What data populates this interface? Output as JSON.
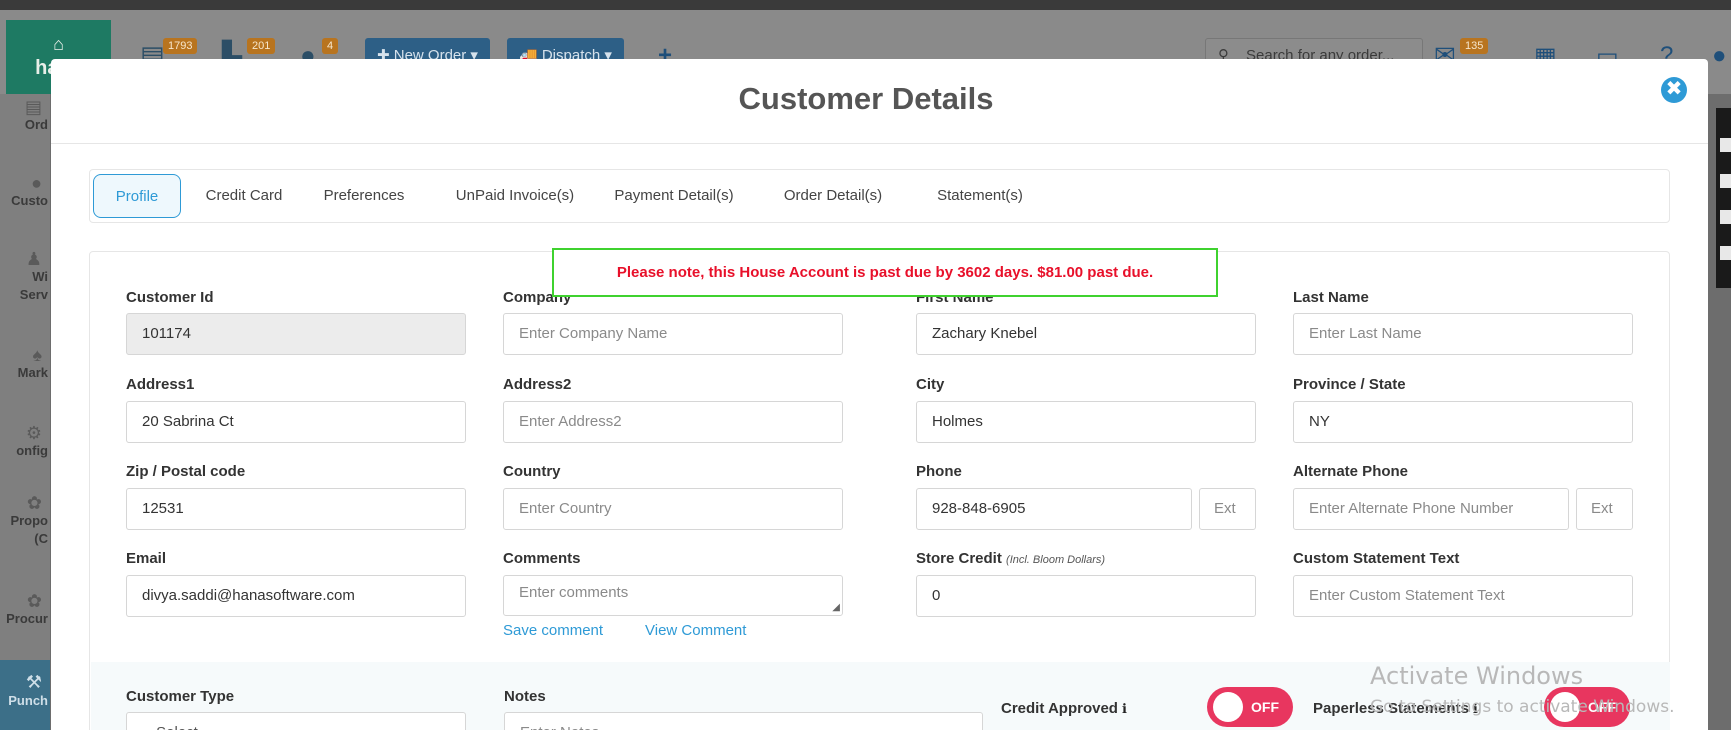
{
  "app": {
    "brand_text": "hana",
    "badges": {
      "orders": "1793",
      "deliveries": "201",
      "chat": "4",
      "mail": "135"
    },
    "new_order_label": "✚ New Order ▾",
    "dispatch_label": "🚚 Dispatch ▾",
    "search_placeholder": "Search for any order...",
    "sidebar": [
      "Ord",
      "Custo",
      "Wi",
      "Serv",
      "Mark",
      "onfig",
      "Propo",
      "(C",
      "Procur"
    ],
    "punch_label": "Punch"
  },
  "modal": {
    "title": "Customer Details",
    "close_glyph": "✖"
  },
  "tabs": [
    {
      "label": "Profile",
      "active": true
    },
    {
      "label": "Credit Card"
    },
    {
      "label": "Preferences"
    },
    {
      "label": "UnPaid Invoice(s)"
    },
    {
      "label": "Payment Detail(s)"
    },
    {
      "label": "Order Detail(s)"
    },
    {
      "label": "Statement(s)"
    }
  ],
  "alert": "Please note, this House Account is past due by 3602 days. $81.00 past due.",
  "fields": {
    "customer_id": {
      "label": "Customer Id",
      "value": "101174"
    },
    "company": {
      "label": "Company",
      "placeholder": "Enter Company Name"
    },
    "first_name": {
      "label": "First Name",
      "value": "Zachary Knebel"
    },
    "last_name": {
      "label": "Last Name",
      "placeholder": "Enter Last Name"
    },
    "address1": {
      "label": "Address1",
      "value": "20 Sabrina Ct"
    },
    "address2": {
      "label": "Address2",
      "placeholder": "Enter Address2"
    },
    "city": {
      "label": "City",
      "value": "Holmes"
    },
    "state": {
      "label": "Province / State",
      "value": "NY"
    },
    "zip": {
      "label": "Zip / Postal code",
      "value": "12531"
    },
    "country": {
      "label": "Country",
      "placeholder": "Enter Country"
    },
    "phone": {
      "label": "Phone",
      "value": "928-848-6905",
      "ext_placeholder": "Ext"
    },
    "alt_phone": {
      "label": "Alternate Phone",
      "placeholder": "Enter Alternate Phone Number",
      "ext_placeholder": "Ext"
    },
    "email": {
      "label": "Email",
      "value": "divya.saddi@hanasoftware.com"
    },
    "comments": {
      "label": "Comments",
      "placeholder": "Enter comments"
    },
    "store_credit": {
      "label": "Store Credit",
      "sub": "(Incl. Bloom Dollars)",
      "value": "0"
    },
    "custom_statement": {
      "label": "Custom Statement Text",
      "placeholder": "Enter Custom Statement Text"
    },
    "customer_type": {
      "label": "Customer Type",
      "value": "-- Select --"
    },
    "notes": {
      "label": "Notes",
      "placeholder": "Enter Notes"
    }
  },
  "links": {
    "save_comment": "Save comment",
    "view_comment": "View Comment"
  },
  "toggles": {
    "credit_approved": {
      "label": "Credit Approved",
      "state": "OFF"
    },
    "paperless": {
      "label": "Paperless Statements",
      "state": "OFF"
    }
  },
  "watermark": {
    "line1": "Activate Windows",
    "line2": "Go to Settings to activate Windows."
  }
}
